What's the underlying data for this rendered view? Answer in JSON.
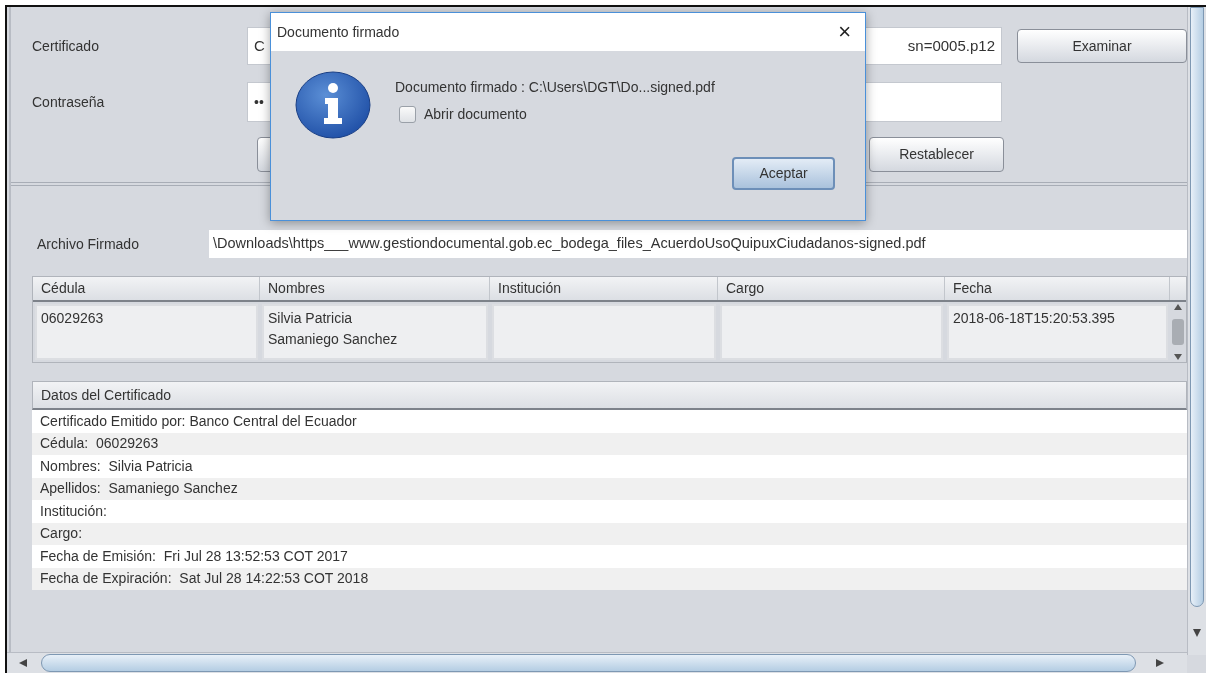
{
  "form": {
    "certificate": {
      "label": "Certificado",
      "value_start": "C",
      "value_end": "sn=0005.p12"
    },
    "browse_button": "Examinar",
    "password": {
      "label": "Contraseña",
      "value": "••"
    },
    "reset_button": "Restablecer"
  },
  "signed_file": {
    "label": "Archivo Firmado",
    "value": "\\Downloads\\https___www.gestiondocumental.gob.ec_bodega_files_AcuerdoUsoQuipuxCiudadanos-signed.pdf"
  },
  "signers_table": {
    "columns": [
      "Cédula",
      "Nombres",
      "Institución",
      "Cargo",
      "Fecha"
    ],
    "rows": [
      [
        "06029263",
        "Silvia Patricia\nSamaniego Sanchez",
        null,
        null,
        "2018-06-18T15:20:53.395"
      ]
    ]
  },
  "certificate_data": {
    "header": "Datos del Certificado",
    "lines": [
      "Certificado Emitido por: Banco Central del Ecuador",
      "Cédula:  06029263",
      "Nombres:  Silvia Patricia",
      "Apellidos:  Samaniego Sanchez",
      "Institución:",
      "Cargo:",
      "Fecha de Emisión:  Fri Jul 28 13:52:53 COT 2017",
      "Fecha de Expiración:  Sat Jul 28 14:22:53 COT 2018"
    ]
  },
  "dialog": {
    "title": "Documento firmado",
    "close": "×",
    "message": "Documento firmado : C:\\Users\\DGT\\Do...signed.pdf",
    "checkbox": {
      "label": "Abrir documento",
      "checked": false
    },
    "button": "Aceptar"
  }
}
